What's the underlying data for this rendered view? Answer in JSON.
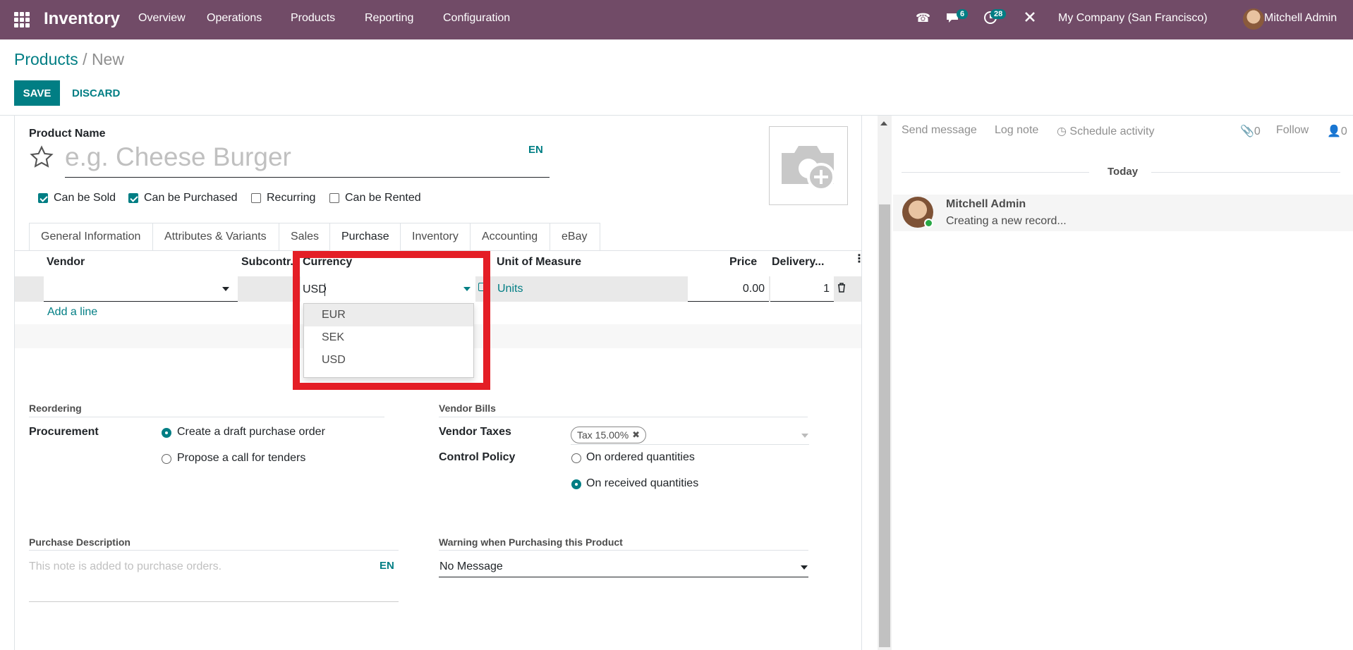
{
  "navbar": {
    "brand": "Inventory",
    "menu": [
      "Overview",
      "Operations",
      "Products",
      "Reporting",
      "Configuration"
    ],
    "messages_count": "6",
    "activities_count": "28",
    "company": "My Company (San Francisco)",
    "user": "Mitchell Admin"
  },
  "breadcrumb": {
    "parent": "Products",
    "separator": "/",
    "current": "New"
  },
  "buttons": {
    "save": "SAVE",
    "discard": "DISCARD"
  },
  "form": {
    "name_label": "Product Name",
    "name_placeholder": "e.g. Cheese Burger",
    "lang": "EN",
    "checkboxes": [
      {
        "label": "Can be Sold",
        "checked": true
      },
      {
        "label": "Can be Purchased",
        "checked": true
      },
      {
        "label": "Recurring",
        "checked": false
      },
      {
        "label": "Can be Rented",
        "checked": false
      }
    ],
    "tabs": [
      "General Information",
      "Attributes & Variants",
      "Sales",
      "Purchase",
      "Inventory",
      "Accounting",
      "eBay"
    ],
    "active_tab": "Purchase"
  },
  "vendor_list": {
    "headers": {
      "vendor": "Vendor",
      "subcontractor": "Subcontr...",
      "currency": "Currency",
      "uom": "Unit of Measure",
      "price": "Price",
      "delivery": "Delivery..."
    },
    "row": {
      "vendor": "",
      "currency": "USD",
      "uom": "Units",
      "price": "0.00",
      "delivery": "1"
    },
    "add_line": "Add a line",
    "currency_options": [
      "EUR",
      "SEK",
      "USD"
    ],
    "highlighted_option": "EUR"
  },
  "reordering": {
    "title": "Reordering",
    "procurement_label": "Procurement",
    "options": [
      {
        "label": "Create a draft purchase order",
        "selected": true
      },
      {
        "label": "Propose a call for tenders",
        "selected": false
      }
    ]
  },
  "vendor_bills": {
    "title": "Vendor Bills",
    "taxes_label": "Vendor Taxes",
    "tax_tag": "Tax 15.00%",
    "control_label": "Control Policy",
    "control_options": [
      {
        "label": "On ordered quantities",
        "selected": false
      },
      {
        "label": "On received quantities",
        "selected": true
      }
    ]
  },
  "purchase_description": {
    "title": "Purchase Description",
    "placeholder": "This note is added to purchase orders.",
    "lang": "EN"
  },
  "purchase_warning": {
    "title": "Warning when Purchasing this Product",
    "value": "No Message"
  },
  "chatter": {
    "send_message": "Send message",
    "log_note": "Log note",
    "schedule_activity": "Schedule activity",
    "attachments": "0",
    "follow": "Follow",
    "followers": "0",
    "date_separator": "Today",
    "message_author": "Mitchell Admin",
    "message_body": "Creating a new record..."
  },
  "colors": {
    "brand": "#714b67",
    "accent": "#017e84",
    "highlight_box": "#e41e26"
  }
}
